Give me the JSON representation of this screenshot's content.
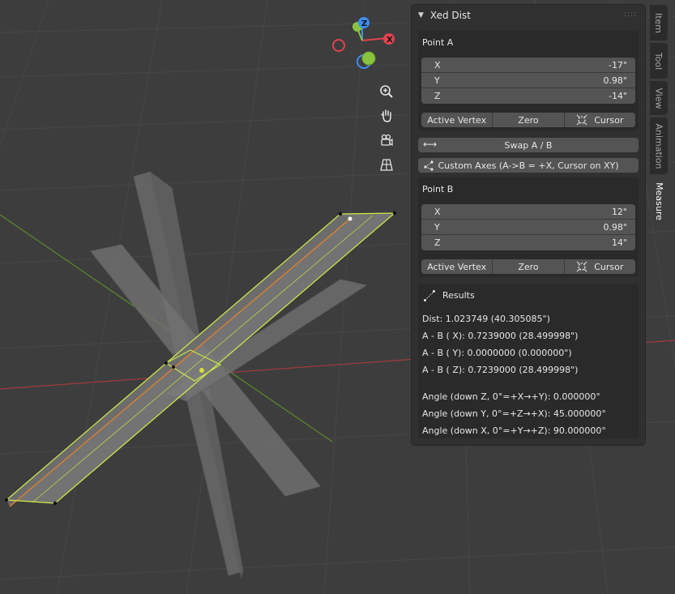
{
  "gizmo": {
    "z": "Z",
    "x": "X",
    "colors": {
      "x": "#e0434f",
      "y": "#8ac43f",
      "z": "#3c8df0"
    }
  },
  "nav_icons": [
    "zoom-icon",
    "hand-pan-icon",
    "camera-icon",
    "grid-perspective-icon"
  ],
  "panel": {
    "title": "Xed Dist",
    "point_a": {
      "title": "Point A",
      "fields": [
        {
          "label": "X",
          "value": "-17\""
        },
        {
          "label": "Y",
          "value": "0.98\""
        },
        {
          "label": "Z",
          "value": "-14\""
        }
      ],
      "buttons": {
        "active_vertex": "Active Vertex",
        "zero": "Zero",
        "cursor": "Cursor"
      }
    },
    "swap_label": "Swap A / B",
    "custom_axes_label": "Custom Axes (A->B = +X, Cursor on XY)",
    "point_b": {
      "title": "Point B",
      "fields": [
        {
          "label": "X",
          "value": "12\""
        },
        {
          "label": "Y",
          "value": "0.98\""
        },
        {
          "label": "Z",
          "value": "14\""
        }
      ],
      "buttons": {
        "active_vertex": "Active Vertex",
        "zero": "Zero",
        "cursor": "Cursor"
      }
    },
    "results": {
      "title": "Results",
      "dist": "Dist: 1.023749 (40.305085\")",
      "ab_x": "A - B ( X): 0.7239000 (28.499998\")",
      "ab_y": "A - B ( Y): 0.0000000 (0.000000\")",
      "ab_z": "A - B ( Z): 0.7239000 (28.499998\")",
      "angle_z": "Angle (down Z, 0°=+X→+Y): 0.000000°",
      "angle_y": "Angle (down Y, 0°=+Z→+X): 45.000000°",
      "angle_x": "Angle (down X, 0°=+Y→+Z): 90.000000°"
    }
  },
  "tabs": [
    "Item",
    "Tool",
    "View",
    "Animation",
    "Measure"
  ],
  "active_tab": "Measure"
}
